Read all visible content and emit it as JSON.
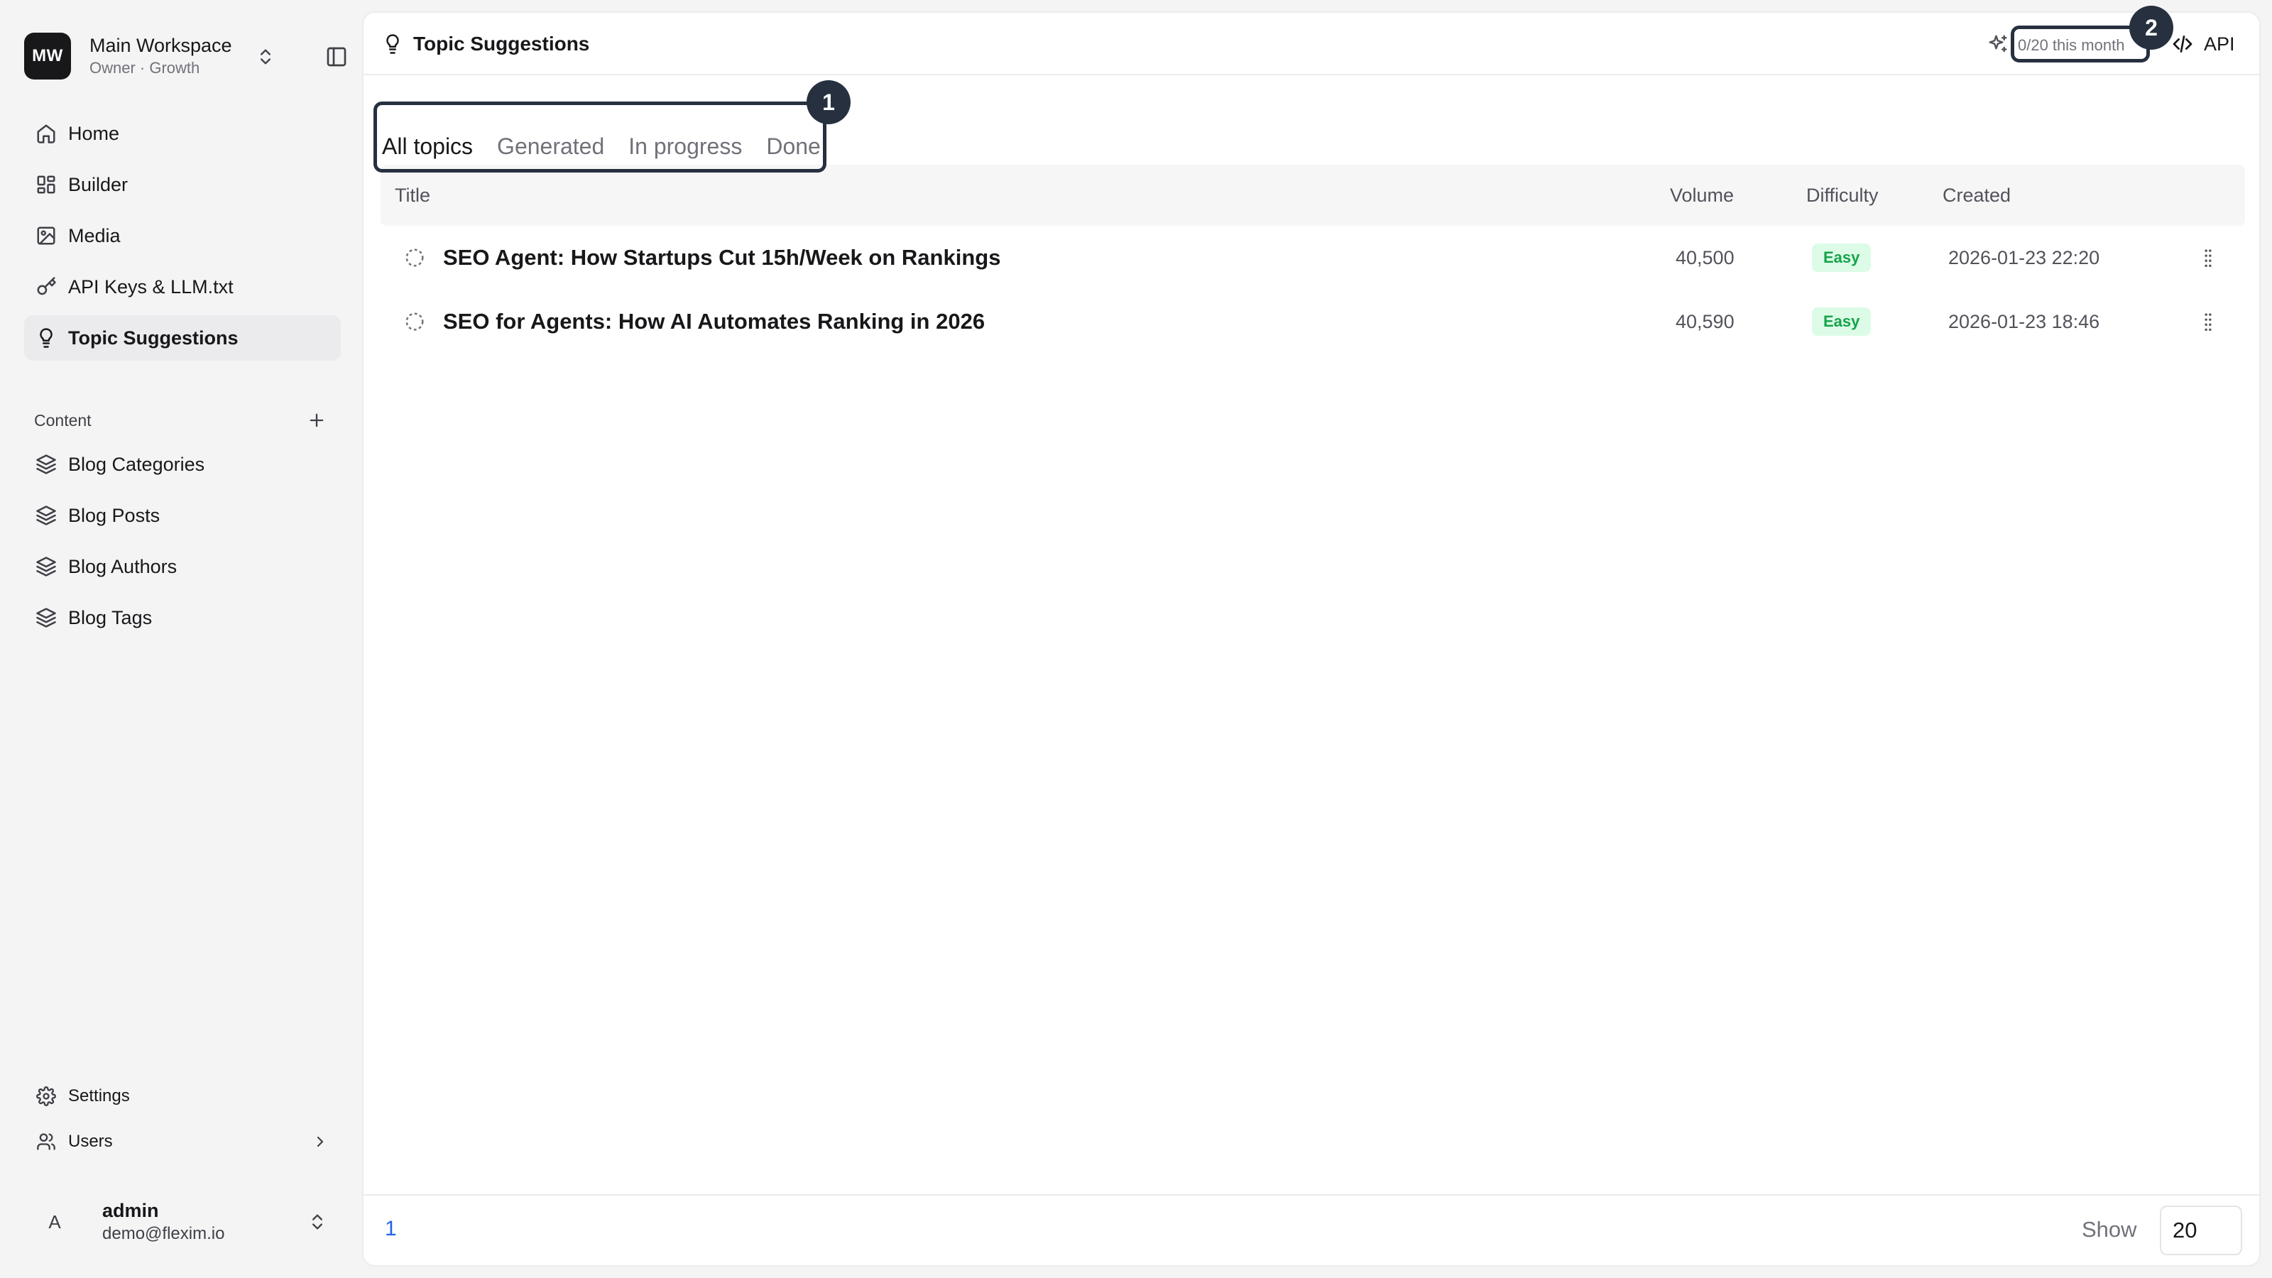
{
  "workspace": {
    "initials": "MW",
    "name": "Main Workspace",
    "subtitle": "Owner · Growth"
  },
  "nav": [
    {
      "label": "Home",
      "icon": "home-icon"
    },
    {
      "label": "Builder",
      "icon": "grid-icon"
    },
    {
      "label": "Media",
      "icon": "image-icon"
    },
    {
      "label": "API Keys & LLM.txt",
      "icon": "key-icon"
    },
    {
      "label": "Topic Suggestions",
      "icon": "lightbulb-icon",
      "active": true
    }
  ],
  "content_group": {
    "title": "Content",
    "items": [
      {
        "label": "Blog Categories",
        "icon": "layers-icon"
      },
      {
        "label": "Blog Posts",
        "icon": "layers-icon"
      },
      {
        "label": "Blog Authors",
        "icon": "layers-icon"
      },
      {
        "label": "Blog Tags",
        "icon": "layers-icon"
      }
    ]
  },
  "bottom_nav": [
    {
      "label": "Settings",
      "icon": "gear-icon"
    },
    {
      "label": "Users",
      "icon": "users-icon"
    }
  ],
  "user": {
    "initial": "A",
    "name": "admin",
    "email": "demo@flexim.io"
  },
  "header": {
    "title": "Topic Suggestions",
    "quota": "0/20 this month",
    "api_label": "API"
  },
  "tabs": [
    {
      "label": "All topics",
      "active": true
    },
    {
      "label": "Generated"
    },
    {
      "label": "In progress"
    },
    {
      "label": "Done"
    }
  ],
  "table": {
    "columns": [
      "Title",
      "Volume",
      "Difficulty",
      "Created"
    ],
    "rows": [
      {
        "title": "SEO Agent: How Startups Cut 15h/Week on Rankings",
        "volume": "40,500",
        "difficulty": "Easy",
        "created": "2026-01-23 22:20"
      },
      {
        "title": "SEO for Agents: How AI Automates Ranking in 2026",
        "volume": "40,590",
        "difficulty": "Easy",
        "created": "2026-01-23 18:46"
      }
    ]
  },
  "pagination": {
    "current_page": "1",
    "show_label": "Show",
    "page_size": "20"
  },
  "annotations": {
    "tabs_marker": "1",
    "quota_marker": "2"
  },
  "colors": {
    "accent_link": "#2563eb",
    "badge_bg": "#dcfce7",
    "badge_text": "#16a34a",
    "annotation": "#27303f"
  }
}
